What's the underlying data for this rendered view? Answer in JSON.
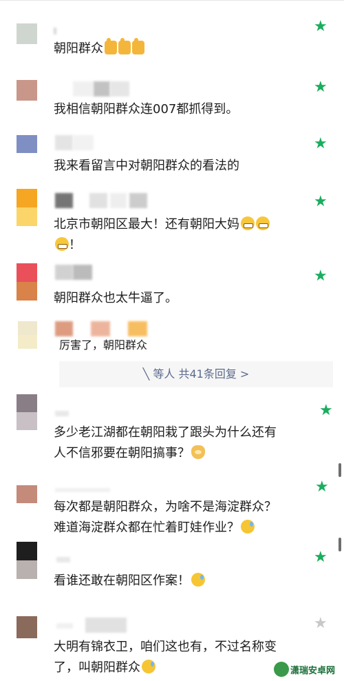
{
  "comments": [
    {
      "text": "朝阳群众",
      "emojis": [
        "thumbs-up",
        "thumbs-up",
        "thumbs-up"
      ],
      "starred": true
    },
    {
      "text": "我相信朝阳群众连007都抓得到。",
      "starred": true
    },
    {
      "text": "我来看留言中对朝阳群众的看法的",
      "starred": true
    },
    {
      "text_line1": "北京市朝阳区最大！还有朝阳大妈",
      "text_line2": "！",
      "starred": true
    },
    {
      "text": "朝阳群众也太牛逼了。",
      "starred": true
    },
    {
      "text": "厉害了，朝阳群众",
      "reply": true
    },
    {
      "reply_summary": "等人 共41条回复 >"
    },
    {
      "text_line1": "多少老江湖都在朝阳栽了跟头为什么还有",
      "text_line2": "人不信邪要在朝阳搞事？",
      "starred": true
    },
    {
      "text_line1": "每次都是朝阳群众，为啥不是海淀群众？",
      "text_line2": "难道海淀群众都在忙着盯娃作业？",
      "starred": true
    },
    {
      "text": "看谁还敢在朝阳区作案！",
      "starred": true
    },
    {
      "text_line1": "大明有锦衣卫，咱们这也有，不过名称变",
      "text_line2": "了，叫朝阳群众",
      "starred": false
    }
  ],
  "reply_icon": "reply-arrow-icon",
  "colors": {
    "star": "#1aad5e",
    "star_inactive": "#c8c8c8",
    "reply_link": "#5b6b8c"
  },
  "watermark": {
    "text": "潇瑞安卓网"
  }
}
